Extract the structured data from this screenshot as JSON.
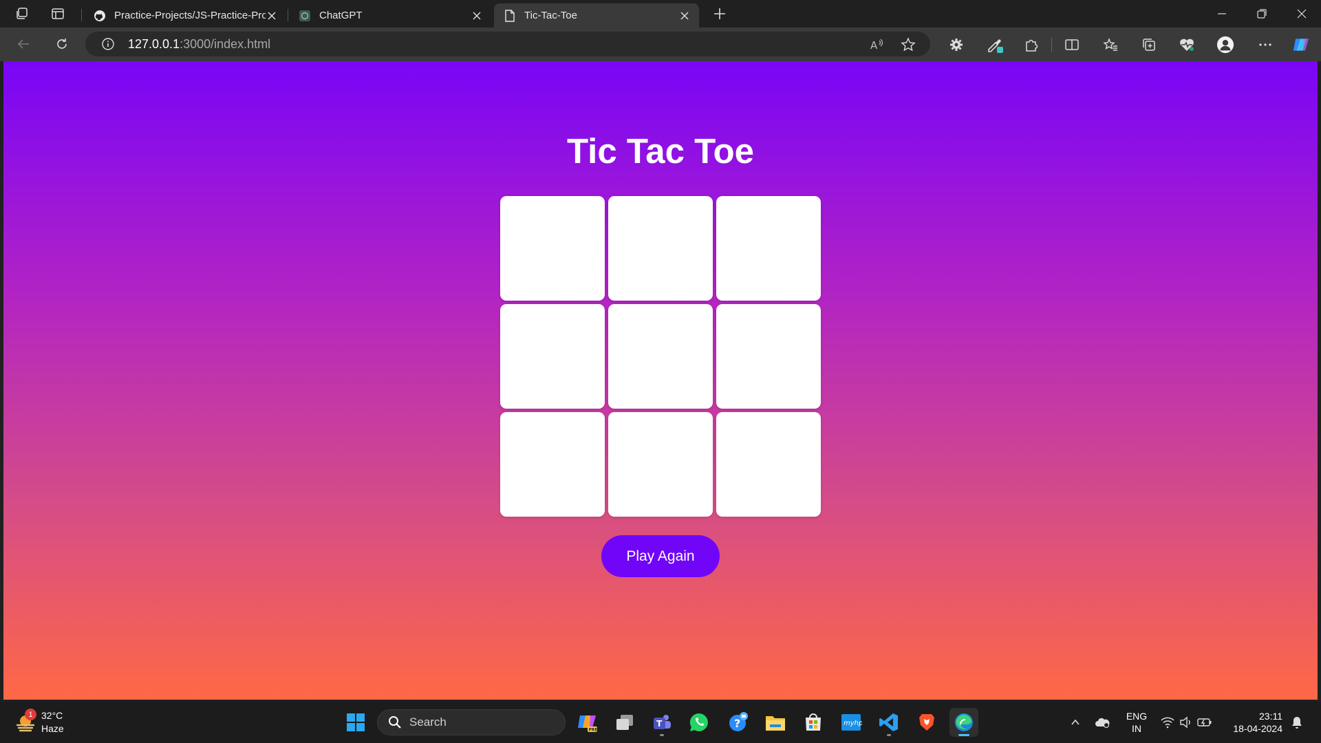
{
  "browser": {
    "tabs": [
      {
        "title": "Practice-Projects/JS-Practice-Projects",
        "favicon": "github-icon",
        "active": false
      },
      {
        "title": "ChatGPT",
        "favicon": "chatgpt-icon",
        "active": false
      },
      {
        "title": "Tic-Tac-Toe",
        "favicon": "page-icon",
        "active": true
      }
    ],
    "address": {
      "host": "127.0.0.1",
      "rest": ":3000/index.html"
    }
  },
  "page": {
    "title": "Tic Tac Toe",
    "board": [
      "",
      "",
      "",
      "",
      "",
      "",
      "",
      "",
      ""
    ],
    "play_again_label": "Play Again",
    "colors": {
      "gradient_top": "#7a05f7",
      "gradient_bottom": "#ff6845",
      "button": "#7005f7",
      "cell": "#ffffff"
    }
  },
  "taskbar": {
    "weather": {
      "temp": "32°C",
      "condition": "Haze",
      "badge": "1"
    },
    "search_label": "Search",
    "apps": [
      "copilot-pre-icon",
      "task-view-icon",
      "teams-icon",
      "whatsapp-icon",
      "messenger-icon",
      "file-explorer-icon",
      "store-icon",
      "myhp-icon",
      "vscode-icon",
      "brave-icon",
      "edge-icon"
    ],
    "language": {
      "line1": "ENG",
      "line2": "IN"
    },
    "clock": {
      "time": "23:11",
      "date": "18-04-2024"
    }
  }
}
